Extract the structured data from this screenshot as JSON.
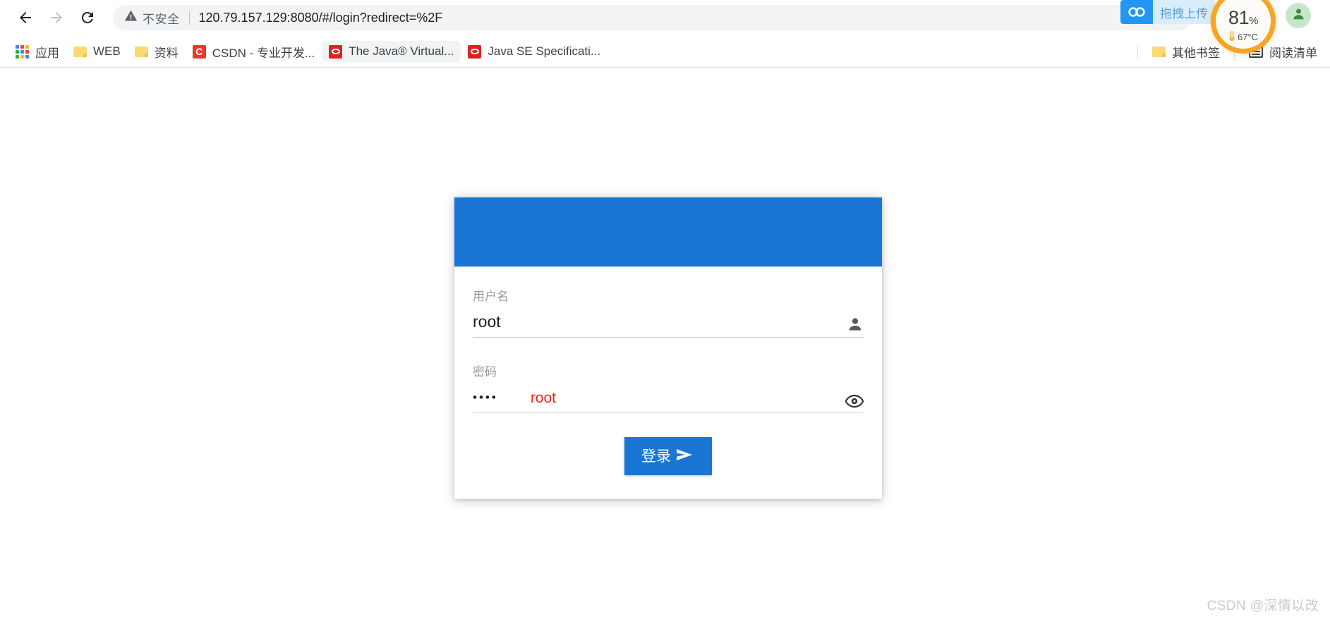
{
  "browser": {
    "nav": {
      "back_icon": "arrow-left-icon",
      "forward_icon": "arrow-right-icon",
      "reload_icon": "reload-icon"
    },
    "omnibox": {
      "security_icon": "warning-triangle-icon",
      "security_label": "不安全",
      "url_host": "120.79.157.129:8080",
      "url_path": "/#/login?redirect=%2F",
      "url_full": "120.79.157.129:8080/#/login?redirect=%2F"
    },
    "bookmarks": [
      {
        "label": "应用",
        "icon": "apps-grid-icon",
        "type": "apps"
      },
      {
        "label": "WEB",
        "icon": "folder-icon",
        "type": "folder"
      },
      {
        "label": "资料",
        "icon": "folder-icon",
        "type": "folder"
      },
      {
        "label": "CSDN - 专业开发...",
        "icon": "csdn-icon",
        "type": "csdn"
      },
      {
        "label": "The Java® Virtual...",
        "icon": "oracle-icon",
        "type": "oracle",
        "hovered": true
      },
      {
        "label": "Java SE Specificati...",
        "icon": "oracle-icon",
        "type": "oracle"
      }
    ],
    "bookmarks_right": {
      "other_bookmarks_label": "其他书签",
      "other_bookmarks_icon": "folder-icon",
      "reading_list_label": "阅读清单",
      "reading_list_icon": "reading-list-icon"
    },
    "overlays": {
      "upload_badge_label": "拖拽上传",
      "upload_badge_icon": "cloud-link-icon",
      "profile_avatar_icon": "person-avatar-icon",
      "cpu_percent": "81",
      "cpu_percent_sign": "%",
      "cpu_temperature": "67°C",
      "cpu_temp_icon": "thermometer-icon"
    },
    "colors": {
      "omnibox_bg": "#f1f3f4",
      "csdn_red": "#e8392c",
      "oracle_red": "#e02020",
      "upload_blue": "#2196f3",
      "cpu_ring_orange": "#f7a427",
      "avatar_green": "#c8e6c9"
    }
  },
  "page": {
    "login_card": {
      "header_color": "#1976d2",
      "username": {
        "label": "用户名",
        "value": "root",
        "icon": "person-icon"
      },
      "password": {
        "label": "密码",
        "value": "••••",
        "annotation": "root",
        "annotation_color": "#f4231f",
        "icon": "eye-icon"
      },
      "submit": {
        "label": "登录",
        "icon": "send-arrow-icon",
        "color": "#1976d2"
      }
    },
    "watermark": "CSDN @深情以改"
  }
}
